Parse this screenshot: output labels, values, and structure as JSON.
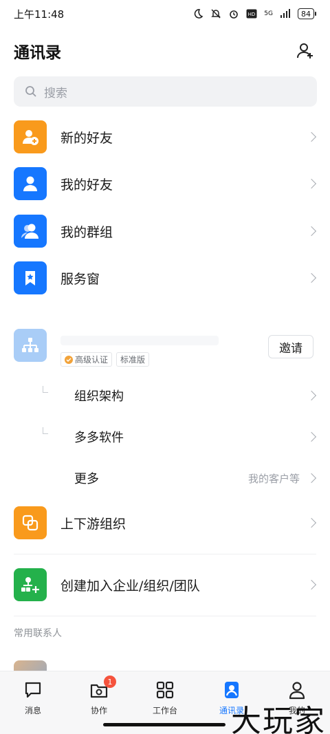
{
  "status_bar": {
    "time": "上午11:48",
    "network": "5G",
    "battery": "84"
  },
  "header": {
    "title": "通讯录"
  },
  "search": {
    "placeholder": "搜索"
  },
  "menu": {
    "new_friends": "新的好友",
    "my_friends": "我的好友",
    "my_groups": "我的群组",
    "service_window": "服务窗"
  },
  "org": {
    "badge_verified": "高级认证",
    "badge_edition": "标准版",
    "invite_label": "邀请",
    "sub_items": [
      "组织架构",
      "多多软件",
      "更多"
    ],
    "more_hint": "我的客户等"
  },
  "upstream_downstream": "上下游组织",
  "create_join": "创建加入企业/组织/团队",
  "frequent_contacts_title": "常用联系人",
  "tabbar": {
    "tabs": [
      "消息",
      "协作",
      "工作台",
      "通讯录",
      "我的"
    ],
    "collab_badge": "1"
  },
  "watermark": "大玩家",
  "colors": {
    "orange": "#f99a1c",
    "blue": "#1677ff",
    "green": "#24b14b",
    "org_light_blue": "#a9cdf7",
    "badge_red": "#f5533d"
  }
}
